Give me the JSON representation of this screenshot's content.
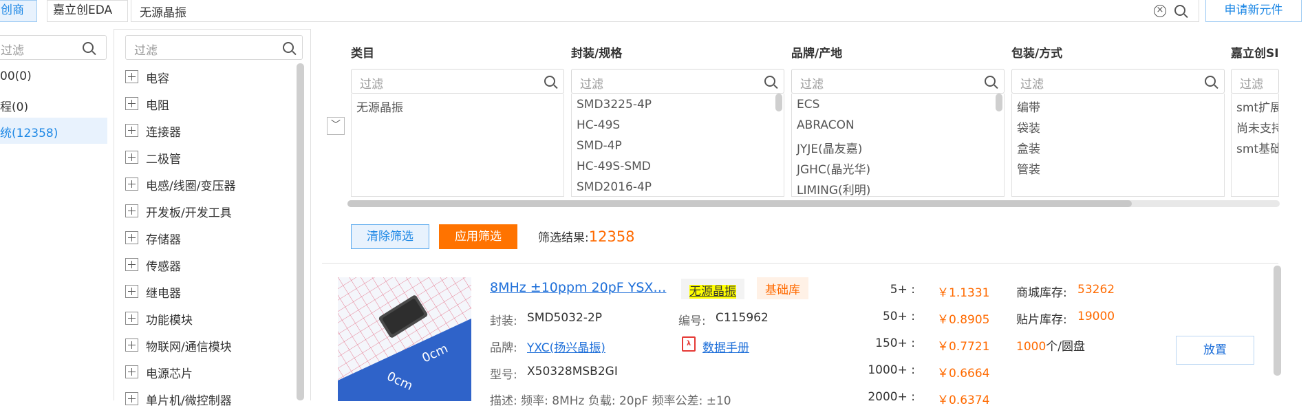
{
  "topbar": {
    "tab_active": "创商城",
    "tab_other": "嘉立创EDA",
    "search_value": "无源晶振",
    "apply_new_label": "申请新元件"
  },
  "left": {
    "filter_placeholder": "过滤",
    "items": [
      "00(0)",
      "程(0)",
      "统(12358)"
    ]
  },
  "tree": {
    "filter_placeholder": "过滤",
    "items": [
      "电容",
      "电阻",
      "连接器",
      "二极管",
      "电感/线圈/变压器",
      "开发板/开发工具",
      "存储器",
      "传感器",
      "继电器",
      "功能模块",
      "物联网/通信模块",
      "电源芯片",
      "单片机/微控制器"
    ]
  },
  "facets": [
    {
      "title": "类目",
      "placeholder": "过滤",
      "items": [
        "无源晶振"
      ]
    },
    {
      "title": "封装/规格",
      "placeholder": "过滤",
      "items": [
        "SMD3225-4P",
        "HC-49S",
        "SMD-4P",
        "HC-49S-SMD",
        "SMD2016-4P"
      ]
    },
    {
      "title": "品牌/产地",
      "placeholder": "过滤",
      "items": [
        "ECS",
        "ABRACON",
        "JYJE(晶友嘉)",
        "JGHC(晶光华)",
        "LIMING(利明)"
      ]
    },
    {
      "title": "包装/方式",
      "placeholder": "过滤",
      "items": [
        "编带",
        "袋装",
        "盒装",
        "管装"
      ]
    },
    {
      "title": "嘉立创SI",
      "placeholder": "过滤",
      "items": [
        "smt扩展",
        "尚未支持",
        "smt基础"
      ]
    }
  ],
  "actions": {
    "clear_label": "清除筛选",
    "apply_label": "应用筛选",
    "result_label": "筛选结果:",
    "result_count": "12358"
  },
  "product": {
    "title": "8MHz ±10ppm 20pF YSX…",
    "tag_category": "无源晶振",
    "tag_lib": "基础库",
    "package_label": "封装:",
    "package": "SMD5032-2P",
    "code_label": "编号:",
    "code": "C115962",
    "brand_label": "品牌:",
    "brand": "YXC(扬兴晶振)",
    "datasheet_label": "数据手册",
    "model_label": "型号:",
    "model": "X50328MSB2GI",
    "desc_partial": "描述:   频率: 8MHz   负载: 20pF   频率公差: ±10",
    "prices": [
      {
        "qty": "5+ :",
        "price": "￥1.1331"
      },
      {
        "qty": "50+ :",
        "price": "￥0.8905"
      },
      {
        "qty": "150+ :",
        "price": "￥0.7721"
      },
      {
        "qty": "1000+ :",
        "price": "￥0.6664"
      },
      {
        "qty": "2000+ :",
        "price": "￥0.6374"
      }
    ],
    "stock_mall_label": "商城库存:",
    "stock_mall": "53262",
    "stock_smt_label": "贴片库存:",
    "stock_smt": "19000",
    "reel_qty": "1000",
    "reel_unit": "个/圆盘",
    "place_label": "放置",
    "image_text_1": "0cm",
    "image_text_2": "0cm"
  }
}
